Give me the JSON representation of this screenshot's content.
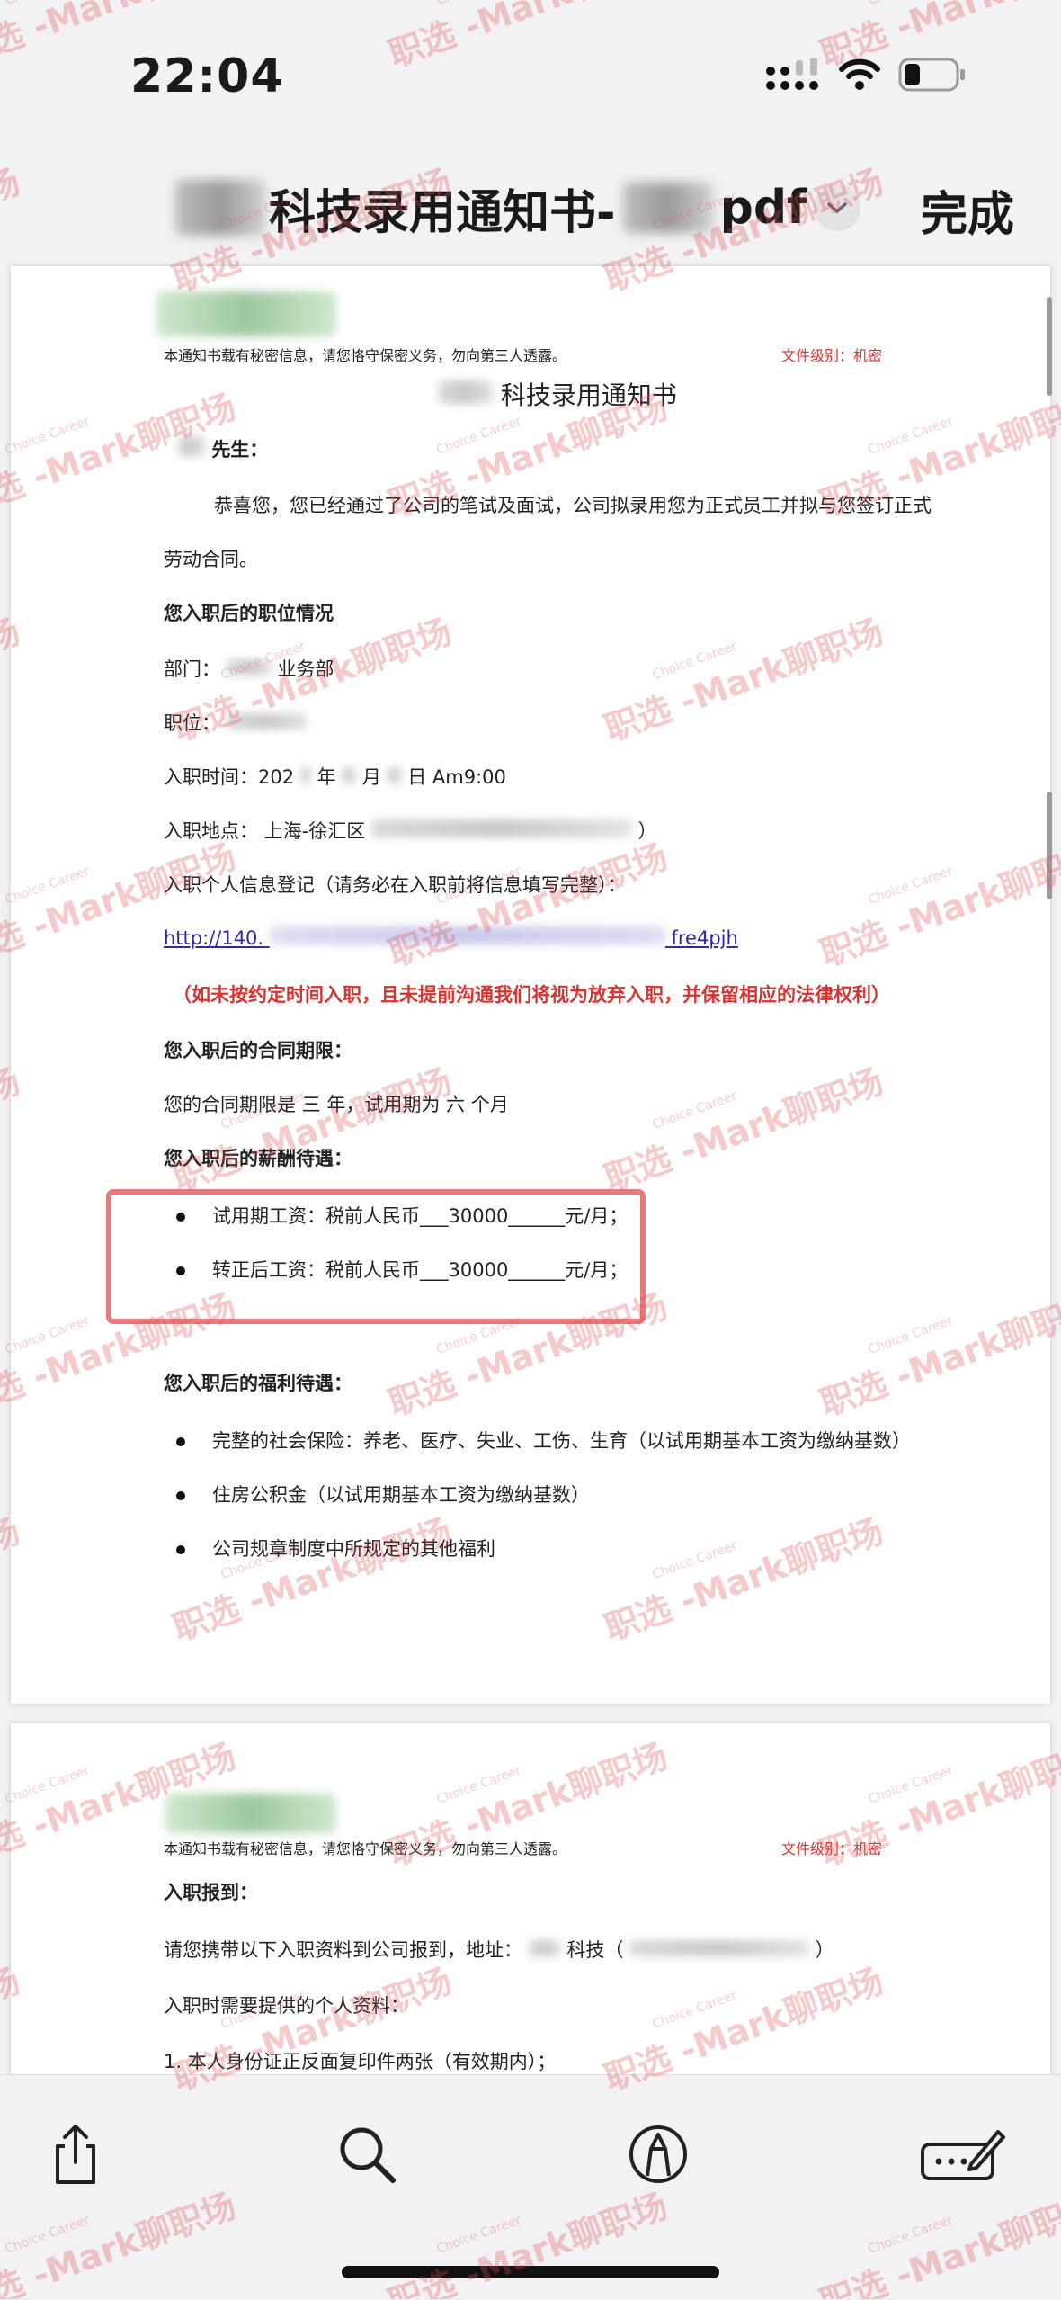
{
  "status_bar": {
    "time": "22:04"
  },
  "nav": {
    "title": "科技录用通知书-",
    "title_suffix": "pdf",
    "done_label": "完成"
  },
  "doc": {
    "confidential_notice": "本通知书载有秘密信息，请您恪守保密义务，勿向第三人透露。",
    "file_level": "文件级别：机密",
    "title": "科技录用通知书",
    "salutation": "先生：",
    "intro_line1": "恭喜您，您已经通过了公司的笔试及面试，公司拟录用您为正式员工并拟与您签订正式",
    "intro_line2": "劳动合同。",
    "position_heading": "您入职后的职位情况",
    "department": "部门：",
    "department_suffix": "业务部",
    "position": "职位：",
    "start_time": "入职时间：202",
    "start_time_year": "年",
    "start_time_month": "月",
    "start_time_day": "日  Am9:00",
    "location": "入职地点：  上海-徐汇区",
    "location_close": "）",
    "registration": "入职个人信息登记（请务必在入职前将信息填写完整）：",
    "link_prefix": "http://140.",
    "link_suffix": "fre4pjh",
    "warning": "（如未按约定时间入职，且未提前沟通我们将视为放弃入职，并保留相应的法律权利）",
    "contract_heading": "您入职后的合同期限：",
    "contract_text": "您的合同期限是 三 年，试用期为 六 个月",
    "salary_heading": "您入职后的薪酬待遇：",
    "salary_items": [
      "试用期工资：税前人民币___30000______元/月；",
      "转正后工资：税前人民币___30000______元/月；"
    ],
    "welfare_heading": "您入职后的福利待遇：",
    "welfare_items": [
      "完整的社会保险：养老、医疗、失业、工伤、生育（以试用期基本工资为缴纳基数）",
      "住房公积金（以试用期基本工资为缴纳基数）",
      "公司规章制度中所规定的其他福利"
    ]
  },
  "doc2": {
    "confidential_notice": "本通知书载有秘密信息，请您恪守保密义务，勿向第三人透露。",
    "file_level": "文件级别：机密",
    "report_heading": "入职报到：",
    "report_text": "请您携带以下入职资料到公司报到，地址：",
    "report_text_mid": "科技（",
    "report_text_end": "）",
    "materials_heading": "入职时需要提供的个人资料：",
    "materials_first": "1.    本人身份证正反面复印件两张（有效期内）；"
  },
  "watermark": {
    "text": "职选 -Mark聊职场",
    "sub": "Choice Career"
  },
  "toolbar": {
    "icons": [
      "share-icon",
      "search-icon",
      "markup-icon",
      "edit-icon"
    ]
  },
  "colors": {
    "accent_red": "#d9322f",
    "highlight_box": "#e9787c",
    "link": "#2a2aa8"
  }
}
